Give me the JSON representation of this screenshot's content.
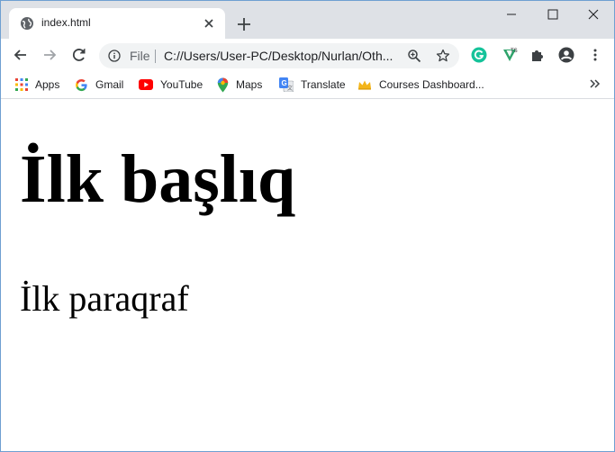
{
  "tab": {
    "title": "index.html"
  },
  "address_bar": {
    "scheme_label": "File",
    "url": "C://Users/User-PC/Desktop/Nurlan/Oth..."
  },
  "bookmarks": [
    {
      "label": "Apps",
      "icon": "apps-grid-icon"
    },
    {
      "label": "Gmail",
      "icon": "google-g-icon"
    },
    {
      "label": "YouTube",
      "icon": "youtube-icon"
    },
    {
      "label": "Maps",
      "icon": "maps-pin-icon"
    },
    {
      "label": "Translate",
      "icon": "translate-icon"
    },
    {
      "label": "Courses Dashboard...",
      "icon": "crown-icon"
    }
  ],
  "extensions": [
    "grammarly-icon",
    "extension-icon-2",
    "puzzle-icon",
    "profile-icon",
    "menu-dots-icon"
  ],
  "page": {
    "heading": "İlk başlıq",
    "paragraph": "İlk paraqraf"
  },
  "colors": {
    "tabstrip": "#dee1e6",
    "omnibox": "#f1f3f4",
    "grammarly": "#15c39a",
    "youtube": "#ff0000"
  }
}
